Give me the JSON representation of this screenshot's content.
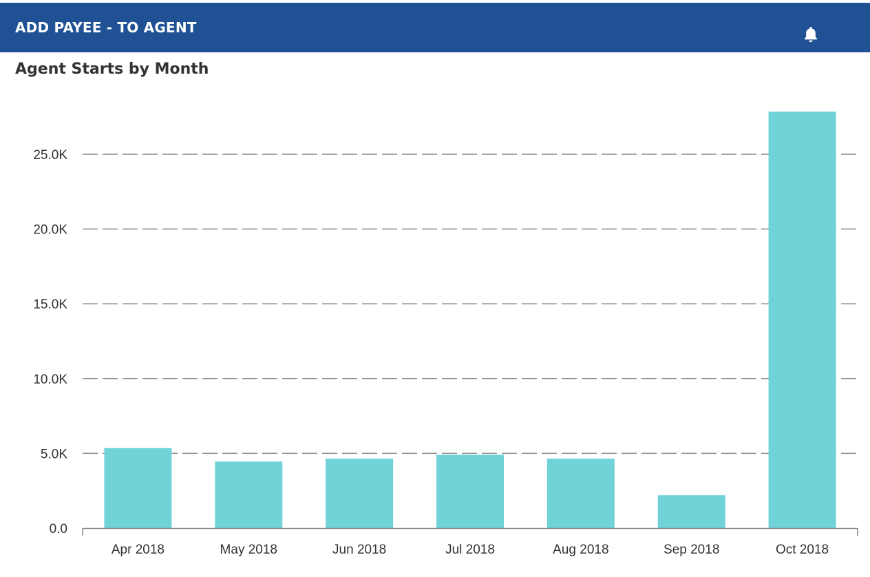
{
  "header": {
    "title": "ADD PAYEE - TO AGENT",
    "bell_icon": "bell-icon"
  },
  "colors": {
    "header_bg": "#1f5194",
    "bar": "#6fd3d8",
    "grid": "#888888"
  },
  "chart_data": {
    "type": "bar",
    "title": "Agent Starts by Month",
    "categories": [
      "Apr 2018",
      "May 2018",
      "Jun 2018",
      "Jul 2018",
      "Aug 2018",
      "Sep 2018",
      "Oct 2018"
    ],
    "values": [
      5350,
      4450,
      4650,
      4900,
      4650,
      2200,
      27850
    ],
    "ylim": [
      0,
      25000
    ],
    "yticks": [
      0,
      5000,
      10000,
      15000,
      20000,
      25000
    ],
    "ytick_labels": [
      "0.0",
      "5.0K",
      "10.0K",
      "15.0K",
      "20.0K",
      "25.0K"
    ],
    "grid": "dashed horizontal",
    "legend": "none"
  }
}
